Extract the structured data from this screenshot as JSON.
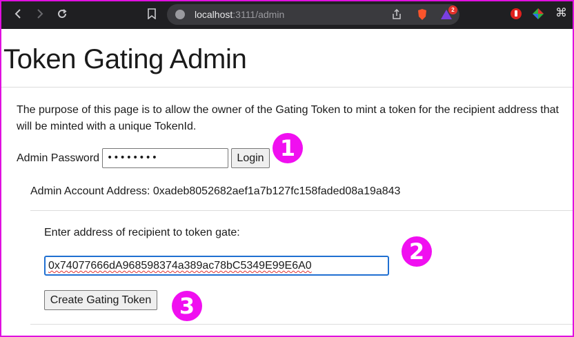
{
  "browser": {
    "url_host": "localhost",
    "url_path": ":3111/admin",
    "extension_badge": "2"
  },
  "page": {
    "title": "Token Gating Admin",
    "intro_line1": "The purpose of this page is to allow the owner of the Gating Token to mint a token for the recipient address that",
    "intro_line2": "will be minted with a unique TokenId.",
    "password_label": "Admin Password",
    "password_value": "••••••••",
    "login_label": "Login",
    "admin_account": "Admin Account Address: 0xadeb8052682aef1a7b127fc158faded08a19a843",
    "recipient_label": "Enter address of recipient to token gate:",
    "recipient_value": "0x74077666dA968598374a389ac78bC5349E99E6A0",
    "create_label": "Create Gating Token"
  },
  "annotations": {
    "step1": "1",
    "step2": "2",
    "step3": "3",
    "color": "#f00ff0"
  }
}
